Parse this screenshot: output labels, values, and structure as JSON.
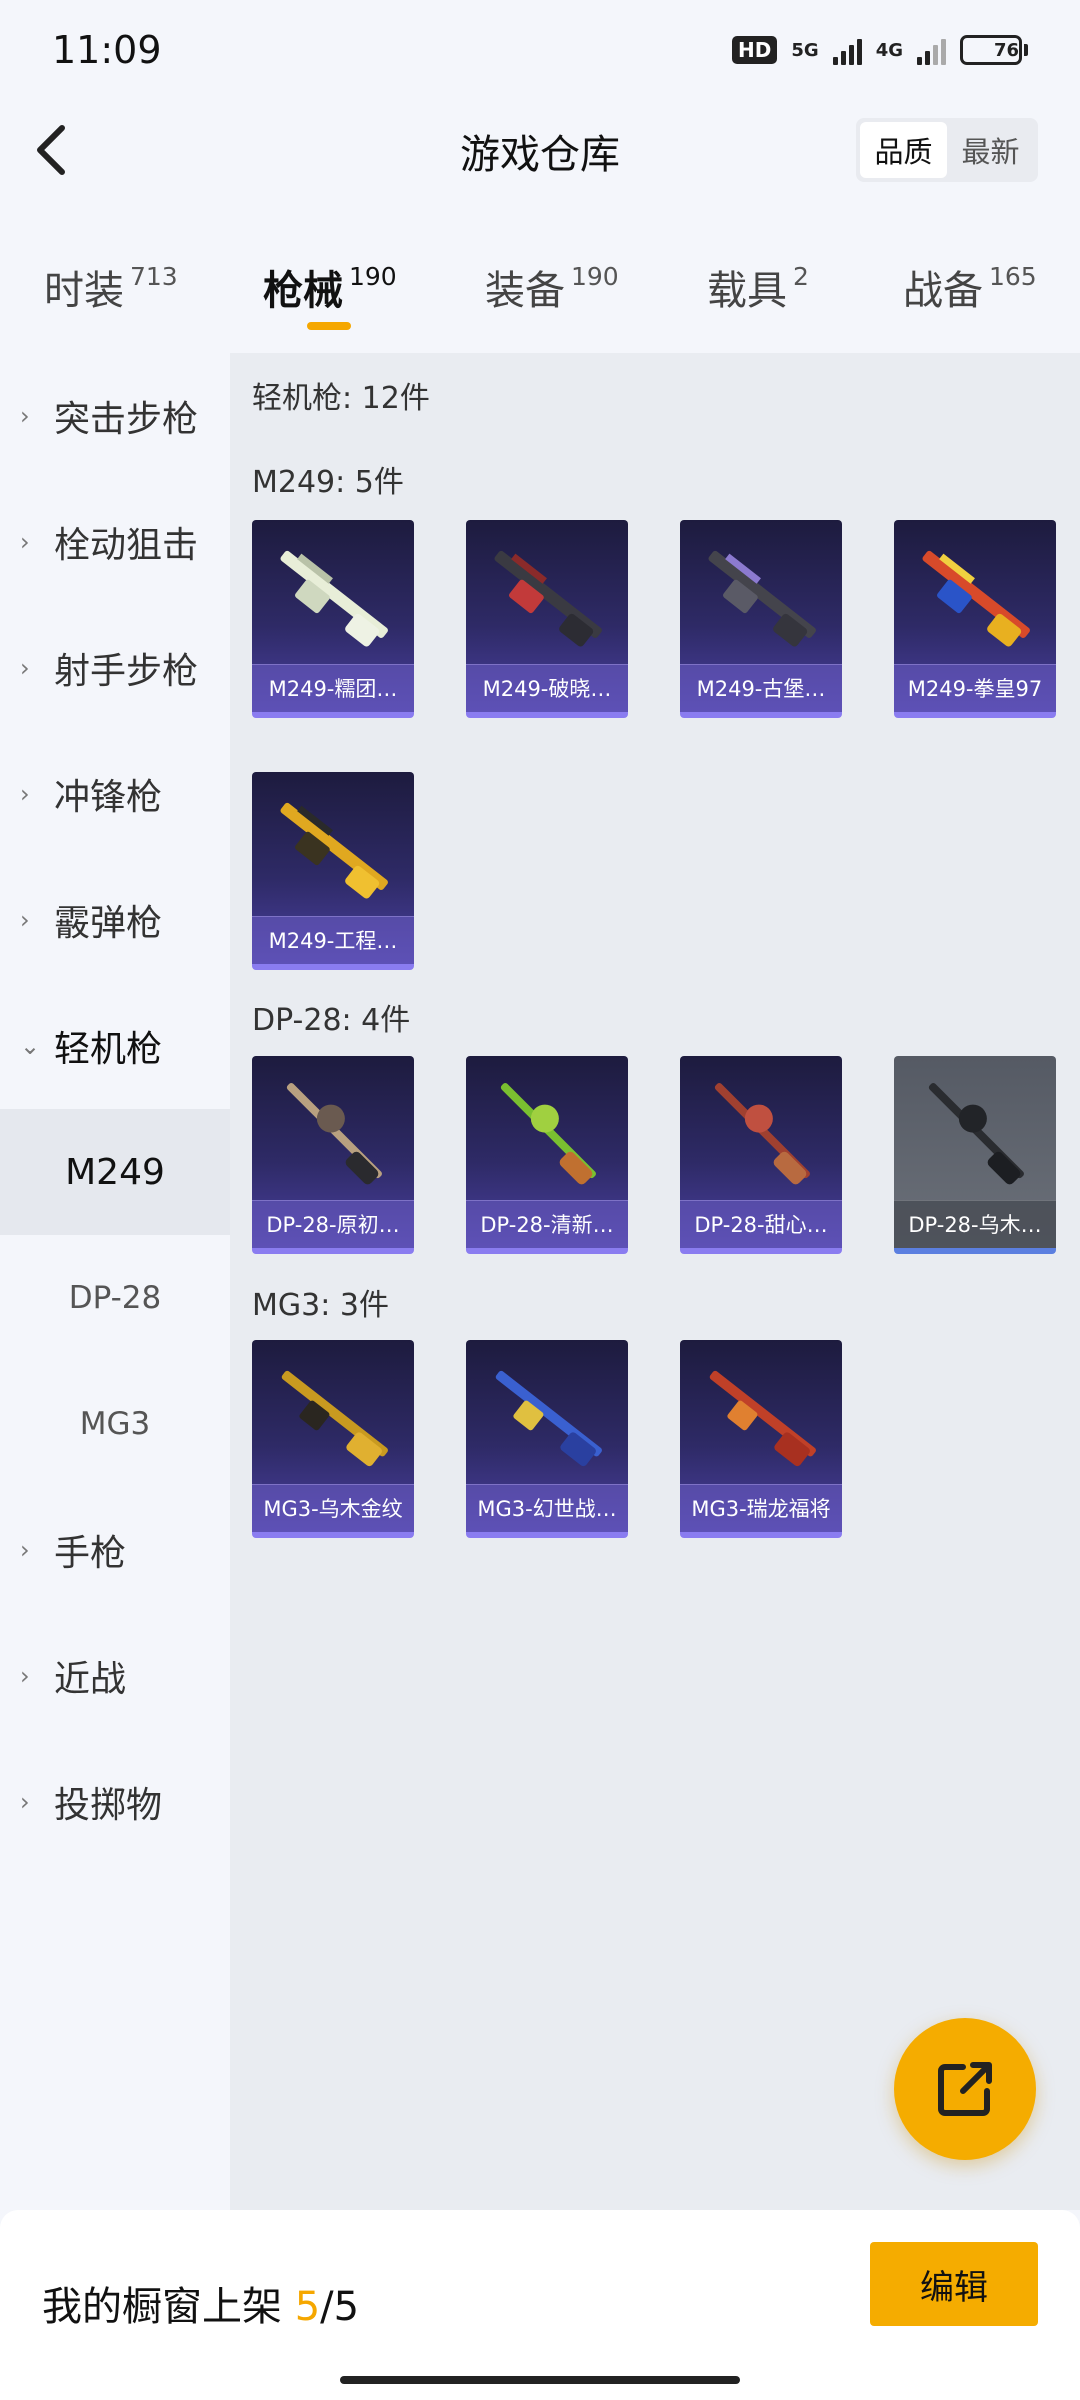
{
  "status": {
    "time": "11:09",
    "hd": "HD",
    "net1": "5G",
    "net2": "4G",
    "battery": "76",
    "battery_level": 0.76
  },
  "header": {
    "title": "游戏仓库",
    "sort_options": [
      "品质",
      "最新"
    ],
    "active_sort": 0
  },
  "tabs": [
    {
      "label": "时装",
      "count": "713"
    },
    {
      "label": "枪械",
      "count": "190"
    },
    {
      "label": "装备",
      "count": "190"
    },
    {
      "label": "载具",
      "count": "2"
    },
    {
      "label": "战备",
      "count": "165"
    }
  ],
  "sidebar": {
    "categories": [
      "突击步枪",
      "栓动狙击",
      "射手步枪",
      "冲锋枪",
      "霰弹枪",
      "轻机枪",
      "手枪",
      "近战",
      "投掷物"
    ],
    "subcategories": [
      "M249",
      "DP-28",
      "MG3"
    ]
  },
  "content": {
    "summary": "轻机枪: 12件",
    "groups": [
      {
        "title": "M249: 5件",
        "items": [
          "M249-糯团…",
          "M249-破晓…",
          "M249-古堡…",
          "M249-拳皇97",
          "M249-工程…"
        ]
      },
      {
        "title": "DP-28: 4件",
        "items": [
          "DP-28-原初…",
          "DP-28-清新…",
          "DP-28-甜心…",
          "DP-28-乌木…"
        ]
      },
      {
        "title": "MG3: 3件",
        "items": [
          "MG3-乌木金纹",
          "MG3-幻世战…",
          "MG3-瑞龙福将"
        ]
      }
    ]
  },
  "bottom": {
    "showcase_label": "我的橱窗上架",
    "showcase_count": "5",
    "showcase_total": "/5",
    "edit_label": "编辑"
  },
  "colors": {
    "accent": "#f5ac00",
    "card_purple": "#2e2a66",
    "card_border": "#8a7cf0"
  }
}
